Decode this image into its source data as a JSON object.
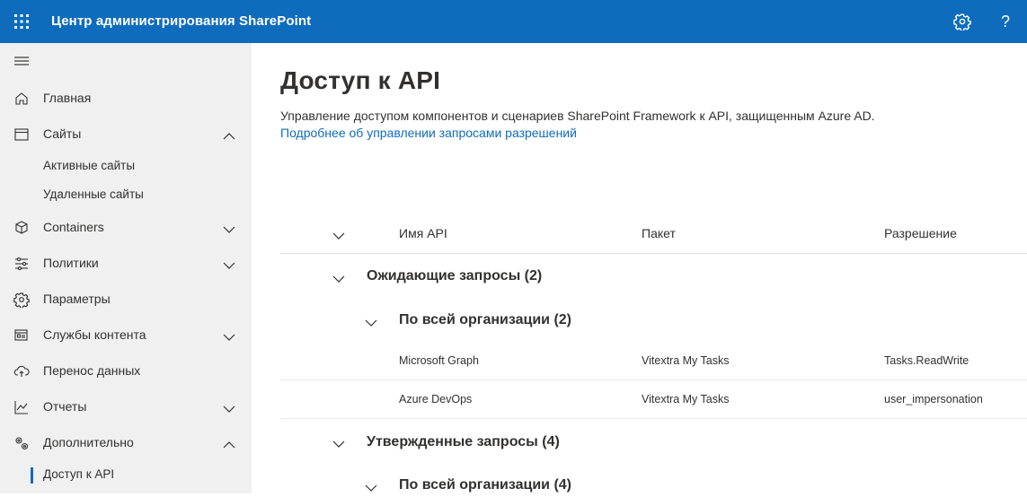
{
  "header": {
    "app_title": "Центр администрирования SharePoint",
    "icons": [
      "app-launcher-icon",
      "settings-icon",
      "help-icon"
    ],
    "help_glyph": "?"
  },
  "sidebar": {
    "items": [
      {
        "label": "Главная",
        "icon": "home-icon"
      },
      {
        "label": "Сайты",
        "icon": "sites-icon",
        "expanded": true
      },
      {
        "label": "Активные сайты"
      },
      {
        "label": "Удаленные сайты"
      },
      {
        "label": "Containers",
        "icon": "containers-icon",
        "expanded": false
      },
      {
        "label": "Политики",
        "icon": "policies-icon",
        "expanded": false
      },
      {
        "label": "Параметры",
        "icon": "settings-icon"
      },
      {
        "label": "Службы контента",
        "icon": "content-services-icon",
        "expanded": false
      },
      {
        "label": "Перенос данных",
        "icon": "migration-icon"
      },
      {
        "label": "Отчеты",
        "icon": "reports-icon",
        "expanded": false
      },
      {
        "label": "Дополнительно",
        "icon": "advanced-icon",
        "expanded": true
      },
      {
        "label": "Доступ к API",
        "active": true
      }
    ]
  },
  "main": {
    "title": "Доступ к API",
    "description": "Управление доступом компонентов и сценариев SharePoint Framework к API, защищенным Azure AD.",
    "learn_more_link": "Подробнее об управлении запросами разрешений",
    "columns": [
      "Имя API",
      "Пакет",
      "Разрешение"
    ],
    "groups": [
      {
        "title": "Ожидающие запросы (2)",
        "subgroup": "По всей организации (2)",
        "rows": [
          {
            "api": "Microsoft Graph",
            "package": "Vitextra My Tasks",
            "permission": "Tasks.ReadWrite"
          },
          {
            "api": "Azure DevOps",
            "package": "Vitextra My Tasks",
            "permission": "user_impersonation"
          }
        ]
      },
      {
        "title": "Утвержденные запросы (4)",
        "subgroup": "По всей организации (4)"
      }
    ]
  },
  "colors": {
    "brand": "#0f6cbd",
    "sidebar_bg": "#f0f0f0",
    "text": "#323130"
  }
}
